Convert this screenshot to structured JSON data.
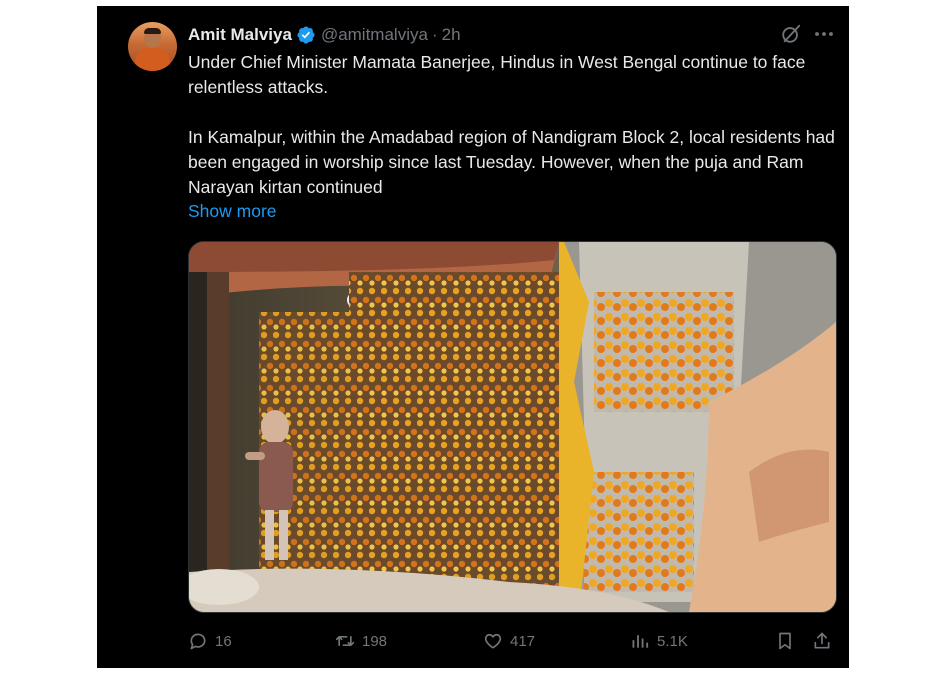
{
  "post": {
    "display_name": "Amit Malviya",
    "verified": true,
    "handle": "@amitmalviya",
    "separator": "·",
    "time": "2h",
    "paragraphs": [
      "Under Chief Minister Mamata Banerjee, Hindus in West Bengal continue to face relentless attacks.",
      "In Kamalpur, within the Amadabad region of Nandigram Block 2, local residents had been engaged in worship since last Tuesday. However, when the puja and Ram Narayan kirtan continued"
    ],
    "show_more": "Show more",
    "header_icons": [
      "grok-icon",
      "more-icon"
    ],
    "media": {
      "kind": "video-still",
      "icon": "image"
    },
    "metrics": {
      "replies": "16",
      "reposts": "198",
      "likes": "417",
      "views": "5.1K"
    },
    "action_icons": [
      "reply-icon",
      "repost-icon",
      "like-icon",
      "views-icon",
      "bookmark-icon",
      "share-icon"
    ]
  },
  "colors": {
    "background": "#000000",
    "text": "#e7e9ea",
    "muted": "#71767b",
    "link": "#1d9bf0",
    "verified": "#1d9bf0"
  }
}
